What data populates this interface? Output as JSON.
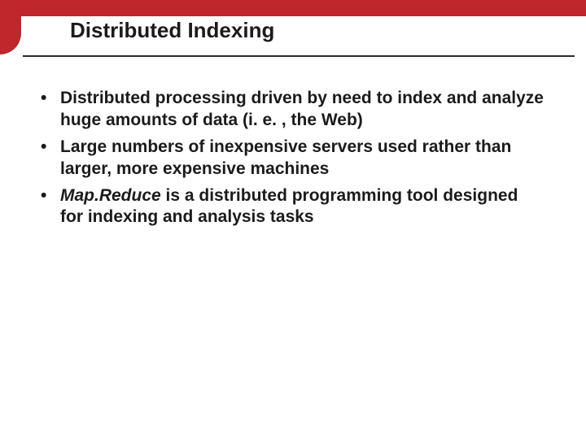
{
  "colors": {
    "accent": "#c0272d",
    "text": "#1b1b1b",
    "rule": "#2b2b2b"
  },
  "title": "Distributed Indexing",
  "bullets": [
    {
      "pre": "",
      "em": "",
      "post": "Distributed processing driven by need to index and analyze huge amounts of data (i. e. , the Web)"
    },
    {
      "pre": "",
      "em": "",
      "post": "Large numbers of inexpensive servers used rather than larger, more expensive machines"
    },
    {
      "pre": "",
      "em": "Map.Reduce",
      "post": " is a distributed programming tool designed for indexing and analysis tasks"
    }
  ]
}
